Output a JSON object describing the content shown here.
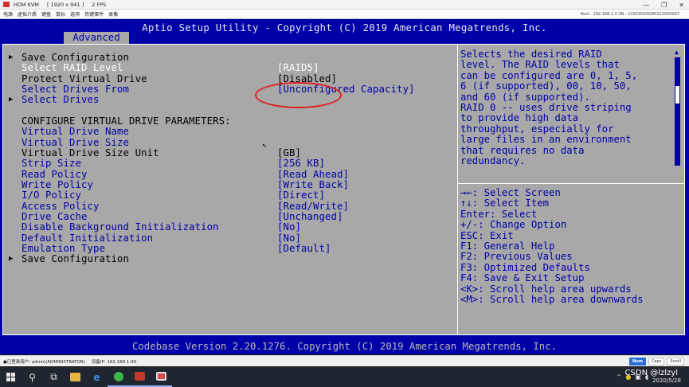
{
  "kvm": {
    "title_app": "HDM KVM",
    "title_res": "[ 1920 x 941 ]",
    "title_fps": "2 FPS",
    "menu": [
      "电源",
      "虚拟介质",
      "键盘",
      "鼠标",
      "选项",
      "热键事件",
      "录像"
    ],
    "host_info": "Host : 192.168.1.2    SN : 210235A3GR0123000007",
    "status_user": "●已登录用户: admin(ADMINISTRATOR)",
    "status_ip": "设备IP: 192.168.1.90",
    "status_btns": [
      "Num",
      "Caps",
      "Scroll"
    ]
  },
  "bios": {
    "header": "Aptio Setup Utility - Copyright (C) 2019 American Megatrends, Inc.",
    "tab": "Advanced",
    "footer": "Codebase Version 2.20.1276. Copyright (C) 2019 American Megatrends, Inc.",
    "arrow_glyph": "▶",
    "rows": [
      {
        "label": "Save Configuration",
        "value": "",
        "submenu": true,
        "style": "black"
      },
      {
        "label": "Select RAID Level",
        "value": "[RAID5]",
        "submenu": false,
        "style": "white"
      },
      {
        "label": "Protect Virtual Drive",
        "value": "[Disabled]",
        "submenu": false,
        "style": "black"
      },
      {
        "label": "Select Drives From",
        "value": "[Unconfigured Capacity]",
        "submenu": false,
        "style": "blue"
      },
      {
        "label": "Select Drives",
        "value": "",
        "submenu": true,
        "style": "blue"
      },
      {
        "label": "CONFIGURE VIRTUAL DRIVE PARAMETERS:",
        "value": "",
        "submenu": false,
        "style": "black"
      },
      {
        "label": "Virtual Drive Name",
        "value": "",
        "submenu": false,
        "style": "blue"
      },
      {
        "label": "Virtual Drive Size",
        "value": "",
        "submenu": false,
        "style": "blue"
      },
      {
        "label": "Virtual Drive Size Unit",
        "value": "[GB]",
        "submenu": false,
        "style": "black"
      },
      {
        "label": "Strip Size",
        "value": "[256 KB]",
        "submenu": false,
        "style": "blue"
      },
      {
        "label": "Read Policy",
        "value": "[Read Ahead]",
        "submenu": false,
        "style": "blue"
      },
      {
        "label": "Write Policy",
        "value": "[Write Back]",
        "submenu": false,
        "style": "blue"
      },
      {
        "label": "I/O Policy",
        "value": "[Direct]",
        "submenu": false,
        "style": "blue"
      },
      {
        "label": "Access Policy",
        "value": "[Read/Write]",
        "submenu": false,
        "style": "blue"
      },
      {
        "label": "Drive Cache",
        "value": "[Unchanged]",
        "submenu": false,
        "style": "blue"
      },
      {
        "label": "Disable Background Initialization",
        "value": "[No]",
        "submenu": false,
        "style": "blue"
      },
      {
        "label": "Default Initialization",
        "value": "[No]",
        "submenu": false,
        "style": "blue"
      },
      {
        "label": "Emulation Type",
        "value": "[Default]",
        "submenu": false,
        "style": "blue"
      },
      {
        "label": "Save Configuration",
        "value": "",
        "submenu": true,
        "style": "black"
      }
    ],
    "help": [
      "Selects the desired RAID",
      "level. The RAID levels that",
      "can be configured are 0, 1, 5,",
      "6 (if supported), 00, 10, 50,",
      "and 60 (if supported).",
      "RAID 0 -- uses drive striping",
      "to provide high data",
      "throughput, especially for",
      "large files in an environment",
      "that requires no data",
      "redundancy."
    ],
    "keys": [
      "→←: Select Screen",
      "↑↓: Select Item",
      "Enter: Select",
      "+/-: Change Option",
      "ESC: Exit",
      "F1: General Help",
      "F2: Previous Values",
      "F3: Optimized Defaults",
      "F4: Save & Exit Setup",
      "<K>: Scroll help area upwards",
      "<M>: Scroll help area downwards"
    ]
  },
  "taskbar": {
    "watermark": "CSDN @lzlzyl",
    "date": "2020/5/28",
    "icons": [
      "start-icon",
      "search-icon",
      "task-view-icon",
      "file-explorer-icon",
      "ie-icon",
      "green-app-icon",
      "kvm-app-icon",
      "media-app-icon"
    ]
  },
  "colors": {
    "bios_blue": "#0000a8",
    "bios_gray": "#a8a8a8",
    "annotation_red": "#e02020"
  }
}
